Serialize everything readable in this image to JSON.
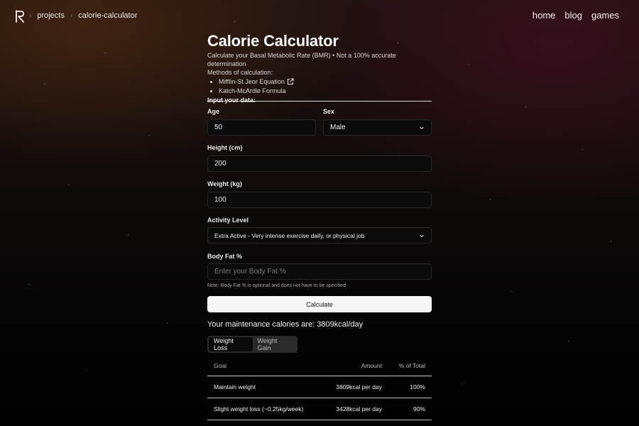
{
  "breadcrumbs": [
    "projects",
    "calorie-calculator"
  ],
  "nav": [
    "home",
    "blog",
    "games"
  ],
  "header": {
    "title": "Calorie Calculator",
    "subtitle": "Calculate your Basal Metabolic Rate (BMR) • Not a 100% accurate determination",
    "methods_label": "Methods of calculation:",
    "methods": [
      "Mifflin-St Jeor Equation",
      "Katch-McArdle Formula"
    ]
  },
  "form": {
    "section_label": "Input your data:",
    "age_label": "Age",
    "age_value": "50",
    "sex_label": "Sex",
    "sex_value": "Male",
    "height_label": "Height (cm)",
    "height_value": "200",
    "weight_label": "Weight (kg)",
    "weight_value": "100",
    "activity_label": "Activity Level",
    "activity_value": "Extra Active - Very intense exercise daily, or physical job",
    "bodyfat_label": "Body Fat %",
    "bodyfat_placeholder": "Enter your Body Fat %",
    "note": "Note: Body Fat % is optional and does not have to be specified.",
    "calculate_label": "Calculate"
  },
  "result": {
    "text": "Your maintenance calories are: 3809kcal/day"
  },
  "tabs": [
    {
      "label": "Weight Loss",
      "active": true
    },
    {
      "label": "Weight Gain",
      "active": false
    }
  ],
  "table": {
    "headers": [
      "Goal",
      "Amount",
      "% of Total"
    ],
    "rows": [
      {
        "goal": "Maintain weight",
        "amount": "3809kcal per day",
        "pct": "100%"
      },
      {
        "goal": "Slight weight loss (~0.25kg/week)",
        "amount": "3428kcal per day",
        "pct": "90%"
      }
    ]
  }
}
